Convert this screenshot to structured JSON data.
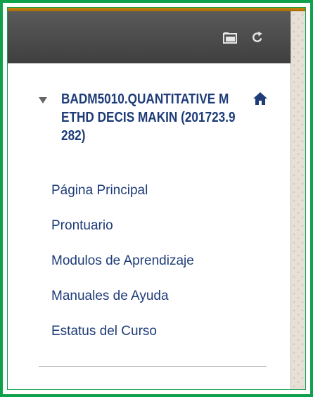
{
  "toolbar": {
    "folder_icon": "folder-icon",
    "refresh_icon": "refresh-icon"
  },
  "course": {
    "title": "BADM5010.QUANTITATIVE METHD DECIS MAKIN (201723.9282)",
    "home_icon": "home-icon",
    "expanded": true
  },
  "nav": {
    "items": [
      {
        "label": "Página Principal"
      },
      {
        "label": "Prontuario"
      },
      {
        "label": "Modulos de Aprendizaje"
      },
      {
        "label": "Manuales de Ayuda"
      },
      {
        "label": "Estatus del Curso"
      }
    ]
  },
  "colors": {
    "frame": "#0ea04a",
    "toolbar": "#4a4a4a",
    "accent": "#c8860c",
    "link": "#1e3c78"
  }
}
